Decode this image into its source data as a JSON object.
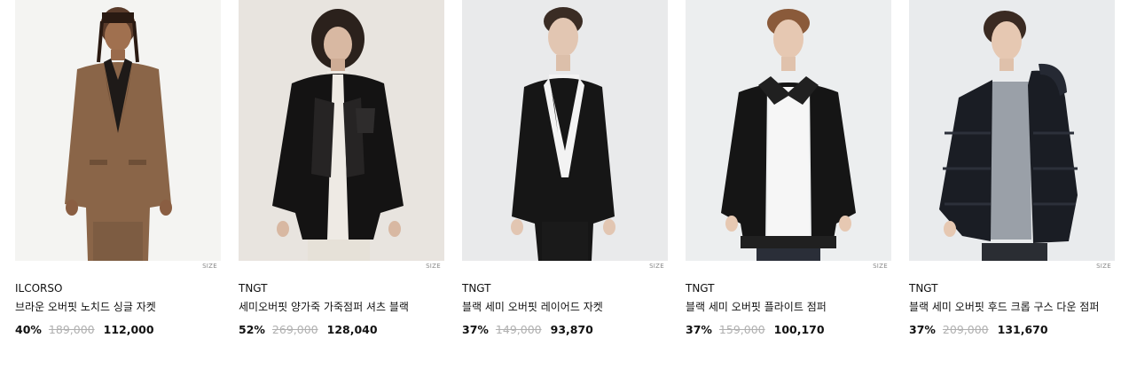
{
  "products": [
    {
      "brand": "ILCORSO",
      "name": "브라운 오버핏 노치드 싱글 자켓",
      "discount": "40%",
      "original_price": "189,000",
      "sale_price": "112,000",
      "size_label": "SIZE"
    },
    {
      "brand": "TNGT",
      "name": "세미오버핏 양가죽 가죽점퍼 셔츠 블랙",
      "discount": "52%",
      "original_price": "269,000",
      "sale_price": "128,040",
      "size_label": "SIZE"
    },
    {
      "brand": "TNGT",
      "name": "블랙 세미 오버핏 레이어드 자켓",
      "discount": "37%",
      "original_price": "149,000",
      "sale_price": "93,870",
      "size_label": "SIZE"
    },
    {
      "brand": "TNGT",
      "name": "블랙 세미 오버핏 플라이트 점퍼",
      "discount": "37%",
      "original_price": "159,000",
      "sale_price": "100,170",
      "size_label": "SIZE"
    },
    {
      "brand": "TNGT",
      "name": "블랙 세미 오버핏 후드 크롭 구스 다운 점퍼",
      "discount": "37%",
      "original_price": "209,000",
      "sale_price": "131,670",
      "size_label": "SIZE"
    }
  ]
}
